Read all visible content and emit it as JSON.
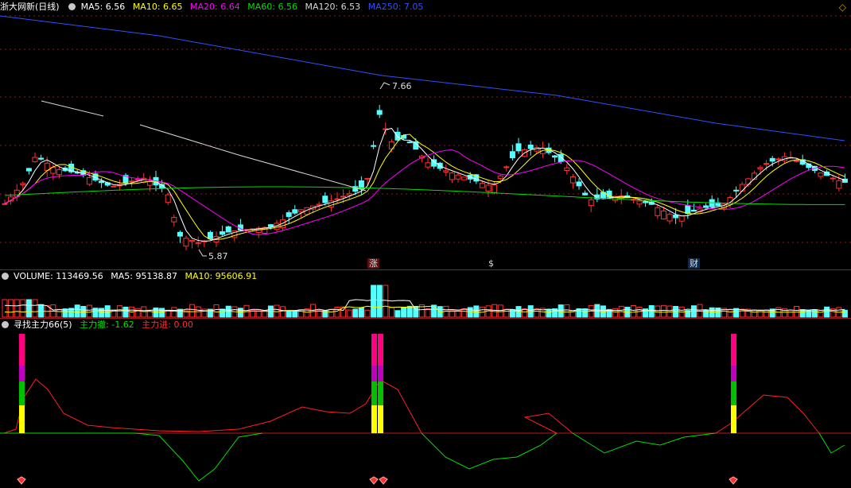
{
  "header": {
    "stock_name": "浙大网新",
    "period": "(日线)",
    "ma": [
      {
        "label": "MA5: 6.56",
        "color": "#ffffff"
      },
      {
        "label": "MA10: 6.65",
        "color": "#ffff00"
      },
      {
        "label": "MA20: 6.64",
        "color": "#ff00ff"
      },
      {
        "label": "MA60: 6.56",
        "color": "#00e000"
      },
      {
        "label": "MA120: 6.53",
        "color": "#d8d8d8"
      },
      {
        "label": "MA250: 7.05",
        "color": "#3050ff"
      }
    ]
  },
  "price_panel": {
    "high_label": "7.66",
    "low_label": "5.87",
    "markers": [
      {
        "text": "涨",
        "color": "#ff4040"
      },
      {
        "text": "$",
        "color": "#ff3030"
      },
      {
        "text": "财",
        "color": "#40a0ff"
      }
    ]
  },
  "volume_panel": {
    "title": "VOLUME: 113469.56",
    "ma5": "MA5: 95138.87",
    "ma10": "MA10: 95606.91"
  },
  "indicator_panel": {
    "title": "寻找主力66(5)",
    "out_label": "主力撤: -1.62",
    "in_label": "主力进: 0.00"
  },
  "colors": {
    "up": "#ff3030",
    "down": "#54ffff",
    "grid": "#8b1a1a",
    "ma250": "#3050ff",
    "ma120": "#d8d8d8",
    "ma60": "#00e000",
    "ma20": "#ff00ff",
    "ma10": "#ffff00",
    "ma5": "#ffffff"
  },
  "icons": {
    "collapse": "circle-icon",
    "diamond": "diamond-icon",
    "corner": "diamond-outline-icon"
  }
}
